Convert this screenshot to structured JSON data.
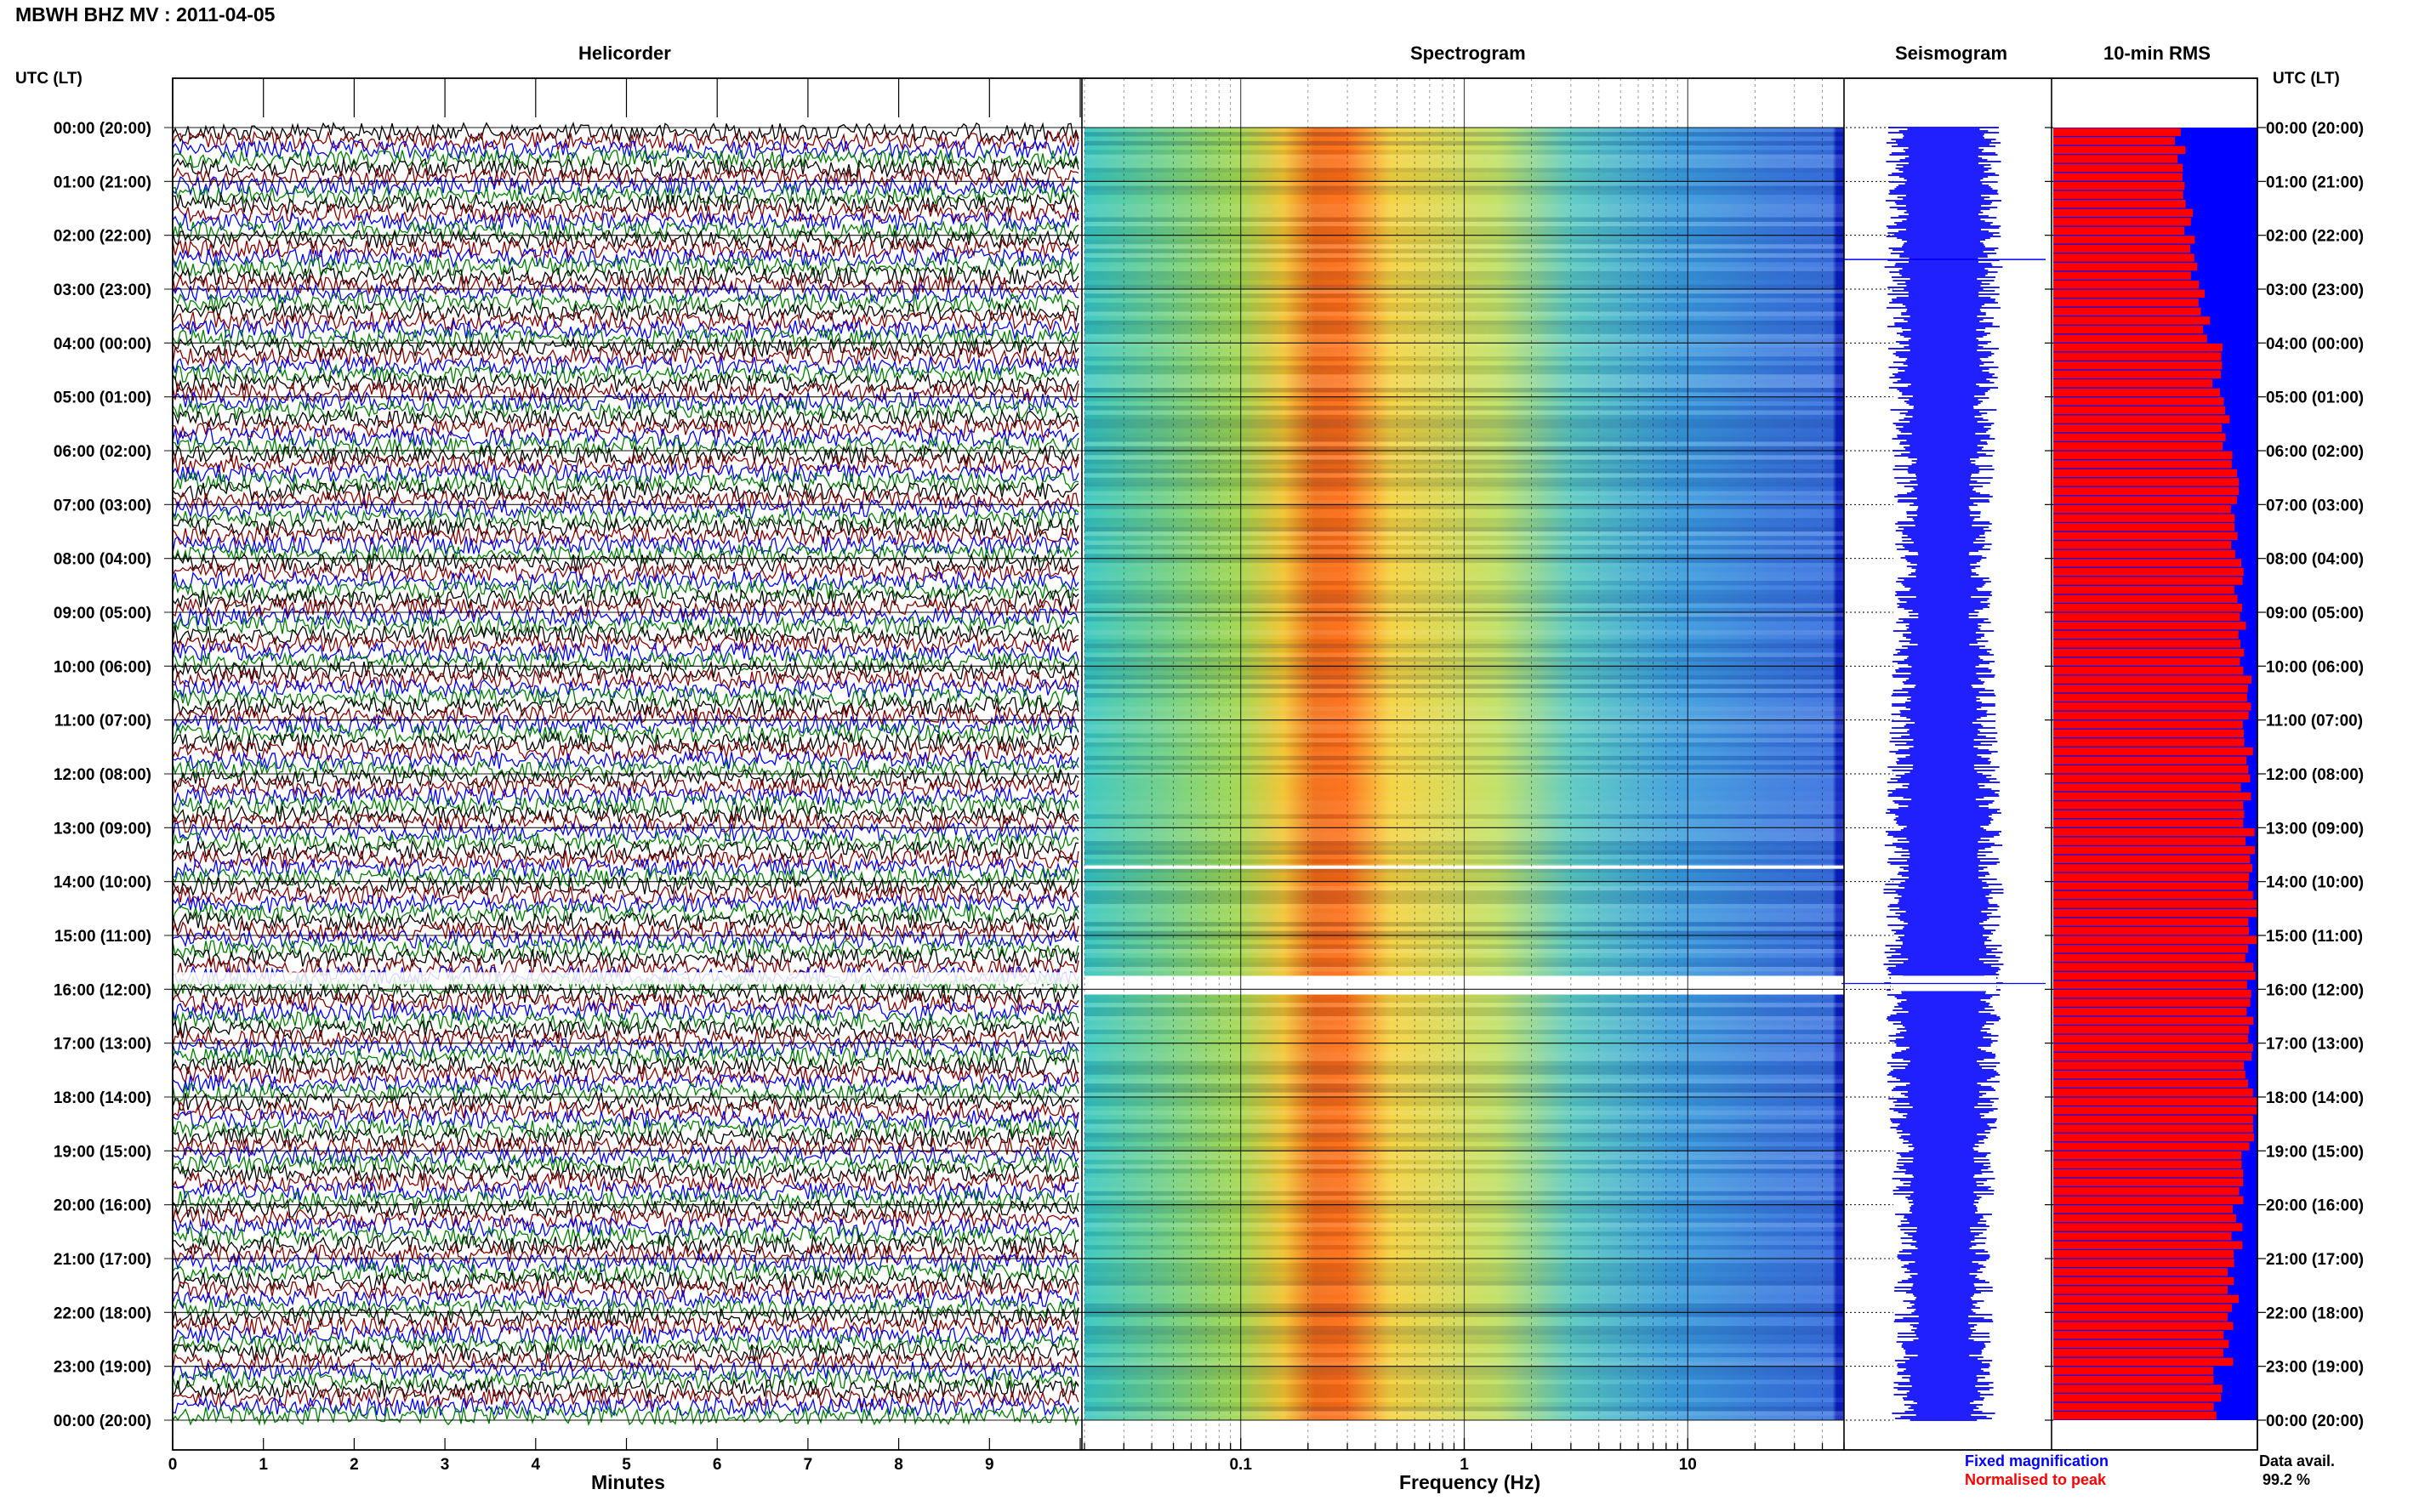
{
  "header": {
    "title": "MBWH BHZ MV : 2011-04-05"
  },
  "panels": {
    "helicorder": "Helicorder",
    "spectrogram": "Spectrogram",
    "seismogram": "Seismogram",
    "rms": "10-min RMS"
  },
  "axes": {
    "left_label": "UTC (LT)",
    "right_label": "UTC (LT)",
    "minutes_label": "Minutes",
    "frequency_label": "Frequency (Hz)"
  },
  "legend": {
    "fixed": "Fixed magnification",
    "normalised": "Normalised to peak",
    "avail_label": "Data avail.",
    "avail_value": "99.2 %"
  },
  "colors": {
    "trace_cycle": [
      "#000000",
      "#8b0000",
      "#0000ff",
      "#008000"
    ],
    "seismogram": "#0000ff",
    "rms_fixed": "#0000ff",
    "rms_normalised": "#ff0000",
    "legend_fixed": "#0000ff",
    "legend_normalised": "#ff0000"
  },
  "chart_data": [
    {
      "type": "line",
      "title": "Helicorder",
      "xlabel": "Minutes",
      "ylabel": "UTC (LT)",
      "x_ticks": [
        "0",
        "1",
        "2",
        "3",
        "4",
        "5",
        "6",
        "7",
        "8",
        "9"
      ],
      "xlim": [
        0,
        10
      ],
      "time_labels_left": [
        "00:00 (20:00)",
        "01:00 (21:00)",
        "02:00 (22:00)",
        "03:00 (23:00)",
        "04:00 (00:00)",
        "05:00 (01:00)",
        "06:00 (02:00)",
        "07:00 (03:00)",
        "08:00 (04:00)",
        "09:00 (05:00)",
        "10:00 (06:00)",
        "11:00 (07:00)",
        "12:00 (08:00)",
        "13:00 (09:00)",
        "14:00 (10:00)",
        "15:00 (11:00)",
        "16:00 (12:00)",
        "17:00 (13:00)",
        "18:00 (14:00)",
        "19:00 (15:00)",
        "20:00 (16:00)",
        "21:00 (17:00)",
        "22:00 (18:00)",
        "23:00 (19:00)",
        "00:00 (20:00)"
      ],
      "traces_per_hour": 6,
      "total_traces": 144,
      "gap_hour_utc": 16
    },
    {
      "type": "heatmap",
      "title": "Spectrogram",
      "xlabel": "Frequency (Hz)",
      "x_scale": "log",
      "xlim": [
        0.02,
        50
      ],
      "x_ticks": [
        "0.1",
        "1",
        "10"
      ],
      "peak_frequency_hz": 0.25,
      "rows_per_hour": 12,
      "gaps_utc": [
        13.7,
        15.75
      ]
    },
    {
      "type": "line",
      "title": "Seismogram",
      "gap_utc": 15.75
    },
    {
      "type": "bar",
      "title": "10-min RMS",
      "orientation": "horizontal",
      "series": [
        {
          "name": "Fixed magnification",
          "color": "#0000ff"
        },
        {
          "name": "Normalised to peak",
          "color": "#ff0000"
        }
      ],
      "data_available_percent": 99.2,
      "normalised_fraction": [
        0.62,
        0.66,
        0.7,
        0.74,
        0.8,
        0.85,
        0.88,
        0.9,
        0.91,
        0.93,
        0.95,
        0.95,
        0.94,
        0.96,
        0.98,
        0.97,
        0.96,
        0.95,
        0.98,
        0.94,
        0.9,
        0.88,
        0.86,
        0.8
      ]
    }
  ]
}
